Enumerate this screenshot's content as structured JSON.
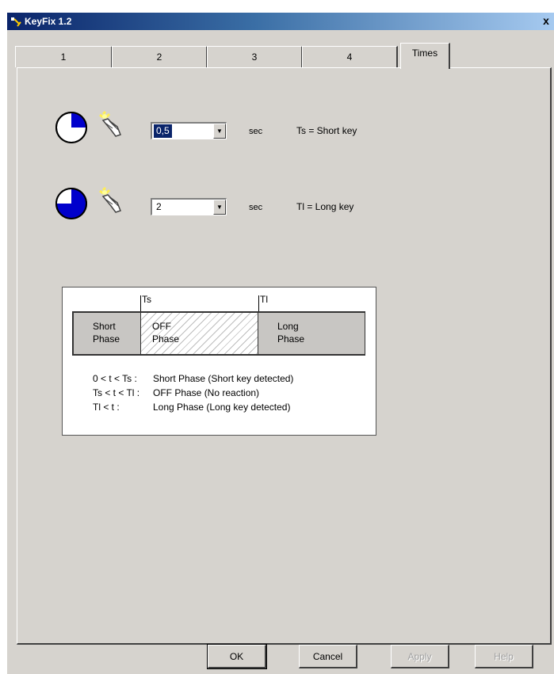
{
  "window": {
    "title": "KeyFix 1.2",
    "close_label": "x"
  },
  "tabs": [
    {
      "label": "1"
    },
    {
      "label": "2"
    },
    {
      "label": "3"
    },
    {
      "label": "4"
    },
    {
      "label": "Times"
    }
  ],
  "short_key": {
    "value": "0,5",
    "unit": "sec",
    "description": "Ts = Short key"
  },
  "long_key": {
    "value": "2",
    "unit": "sec",
    "description": "Tl = Long key"
  },
  "diagram": {
    "ts_label": "Ts",
    "tl_label": "Tl",
    "short_phase": {
      "line1": "Short",
      "line2": "Phase"
    },
    "off_phase": {
      "line1": "OFF",
      "line2": "Phase"
    },
    "long_phase": {
      "line1": "Long",
      "line2": "Phase"
    },
    "legend": [
      {
        "key": "0 < t < Ts :",
        "text": "Short Phase (Short key detected)"
      },
      {
        "key": "Ts < t < Tl :",
        "text": "OFF Phase (No reaction)"
      },
      {
        "key": "Tl < t :",
        "text": "Long Phase (Long key detected)"
      }
    ]
  },
  "buttons": {
    "ok": "OK",
    "cancel": "Cancel",
    "apply": "Apply",
    "help": "Help"
  },
  "colors": {
    "title_bar": "#0a246a",
    "dialog_bg": "#d6d3ce",
    "clock_fill": "#0000cc"
  }
}
